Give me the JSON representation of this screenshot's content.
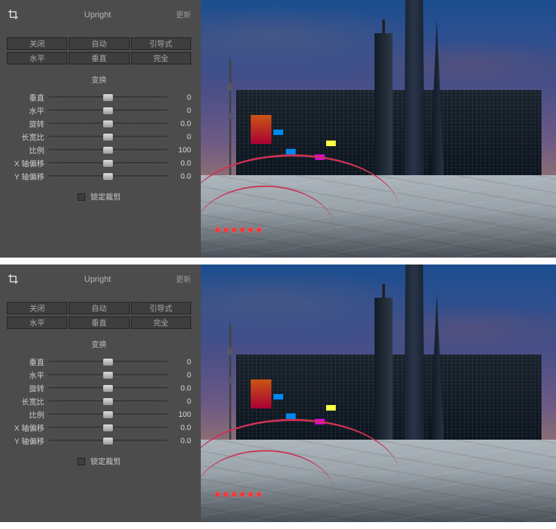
{
  "header": {
    "title": "Upright",
    "update": "更新"
  },
  "buttons": {
    "row1": [
      "关闭",
      "自动",
      "引导式"
    ],
    "row2": [
      "水平",
      "垂直",
      "完全"
    ]
  },
  "section": {
    "transform": "变换"
  },
  "sliders": [
    {
      "label": "垂直",
      "value": "0"
    },
    {
      "label": "水平",
      "value": "0"
    },
    {
      "label": "旋转",
      "value": "0.0"
    },
    {
      "label": "长宽比",
      "value": "0"
    },
    {
      "label": "比例",
      "value": "100"
    },
    {
      "label": "X 轴偏移",
      "value": "0.0"
    },
    {
      "label": "Y 轴偏移",
      "value": "0.0"
    }
  ],
  "lock": {
    "label": "锁定裁剪"
  }
}
